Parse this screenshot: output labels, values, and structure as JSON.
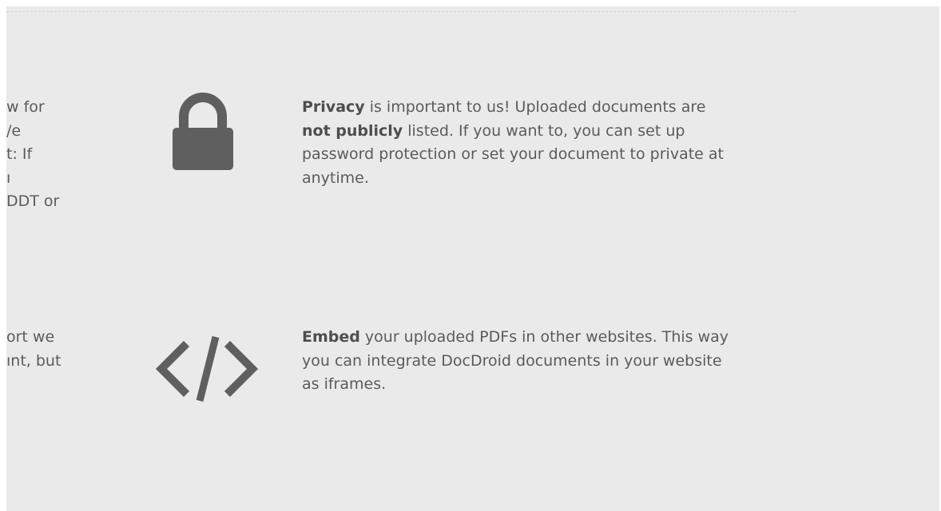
{
  "left_column_fragments": {
    "top": [
      "w for",
      "/e",
      "t: If",
      "ı",
      "DDT or"
    ],
    "bottom": [
      "ort we",
      "ınt, but"
    ]
  },
  "features": {
    "privacy": {
      "icon": "lock-icon",
      "lead": "Privacy",
      "text_a": " is important to us! Uploaded documents are ",
      "bold_b": "not publicly",
      "text_c": " listed. If you want to, you can set up password protection or set your document to private at anytime."
    },
    "embed": {
      "icon": "code-icon",
      "lead": "Embed",
      "text_a": " your uploaded PDFs in other websites. This way you can integrate DocDroid documents in your website as iframes."
    }
  },
  "colors": {
    "background": "#eaeaea",
    "icon": "#5f5f5f",
    "text": "#5b5b5b"
  }
}
